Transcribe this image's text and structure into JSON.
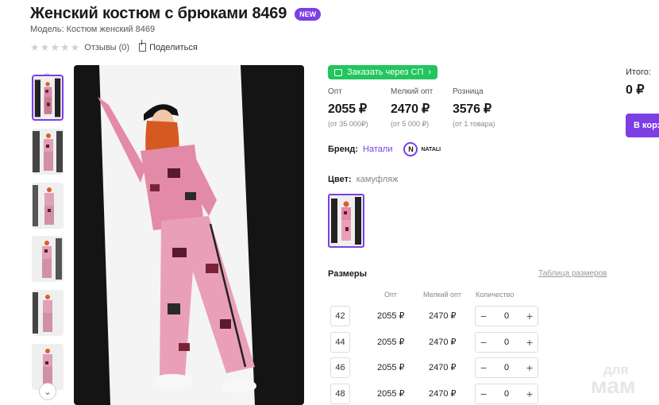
{
  "product": {
    "title": "Женский костюм с брюками 8469",
    "badge": "NEW",
    "model": "Модель: Костюм женский 8469",
    "reviews": "Отзывы (0)",
    "share": "Поделиться"
  },
  "order": {
    "label": "Заказать через СП"
  },
  "prices": [
    {
      "label": "Опт",
      "value": "2055 ₽",
      "sub": "(от 35 000₽)"
    },
    {
      "label": "Мелкий опт",
      "value": "2470 ₽",
      "sub": "(от 5 000 ₽)"
    },
    {
      "label": "Розница",
      "value": "3576 ₽",
      "sub": "(от 1 товара)"
    }
  ],
  "brand": {
    "label": "Бренд:",
    "name": "Натали",
    "logo_text": "NATALI",
    "logo_letter": "N"
  },
  "color": {
    "label": "Цвет:",
    "value": "камуфляж"
  },
  "sizes": {
    "title": "Размеры",
    "table_link": "Таблица размеров",
    "headers": [
      "Опт",
      "Мелкий опт",
      "Количество"
    ],
    "rows": [
      {
        "size": "42",
        "opt": "2055 ₽",
        "small": "2470 ₽",
        "qty": "0"
      },
      {
        "size": "44",
        "opt": "2055 ₽",
        "small": "2470 ₽",
        "qty": "0"
      },
      {
        "size": "46",
        "opt": "2055 ₽",
        "small": "2470 ₽",
        "qty": "0"
      },
      {
        "size": "48",
        "opt": "2055 ₽",
        "small": "2470 ₽",
        "qty": "0"
      }
    ]
  },
  "summary": {
    "total_label": "Итого:",
    "total_value": "0 ₽",
    "cart_button": "В корзину"
  },
  "watermark": {
    "line1": "для",
    "line2": "мам"
  },
  "colors": {
    "accent": "#7b3fe4",
    "green": "#22c55e",
    "camo_pink": "#e59bb3",
    "camo_dark": "#5a1a2e"
  }
}
